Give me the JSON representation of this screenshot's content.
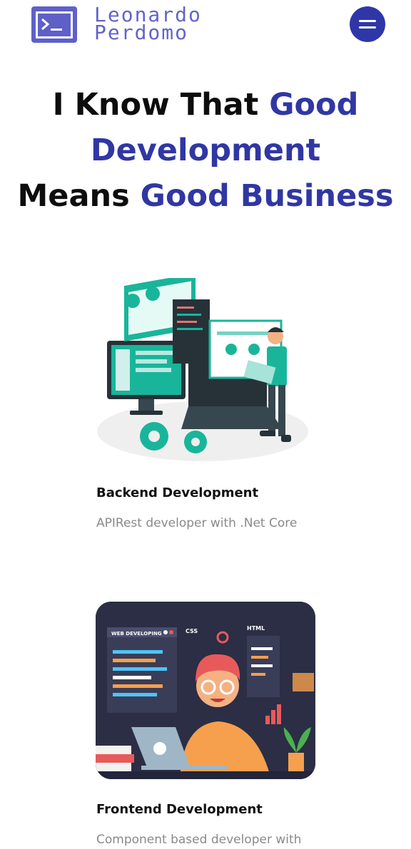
{
  "header": {
    "brand_line1": "Leonardo",
    "brand_line2": "Perdomo",
    "logo_icon": "terminal-icon",
    "menu_icon": "hamburger-menu-icon"
  },
  "hero": {
    "part1": "I Know That ",
    "part2": "Good Development",
    "part3": "Means ",
    "part4": "Good Business"
  },
  "services": [
    {
      "title": "Backend Development",
      "description": "APIRest developer with .Net Core"
    },
    {
      "title": "Frontend Development",
      "description": "Component based developer with"
    }
  ],
  "frontend_illustration": {
    "panel_title": "WEB DEVELOPING",
    "label_css": "CSS",
    "label_html": "HTML"
  },
  "colors": {
    "accent": "#3037a3",
    "brand": "#6264c9",
    "teal": "#19b59a"
  }
}
